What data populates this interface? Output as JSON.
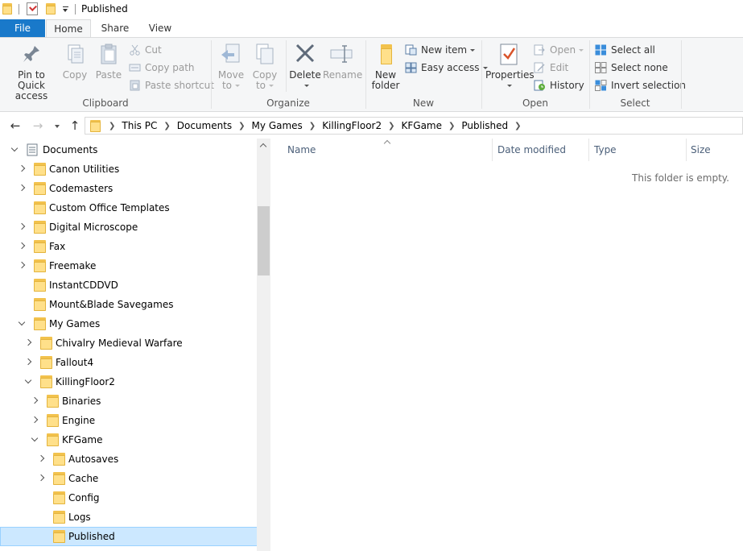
{
  "window": {
    "title": "Published"
  },
  "tabs": {
    "file": "File",
    "home": "Home",
    "share": "Share",
    "view": "View"
  },
  "ribbon": {
    "clipboard": {
      "label": "Clipboard",
      "pin_line1": "Pin to Quick",
      "pin_line2": "access",
      "copy": "Copy",
      "paste": "Paste",
      "cut": "Cut",
      "copy_path": "Copy path",
      "paste_shortcut": "Paste shortcut"
    },
    "organize": {
      "label": "Organize",
      "move_line1": "Move",
      "move_line2": "to",
      "copy_line1": "Copy",
      "copy_line2": "to",
      "delete": "Delete",
      "rename": "Rename"
    },
    "new": {
      "label": "New",
      "folder_line1": "New",
      "folder_line2": "folder",
      "new_item": "New item",
      "easy_access": "Easy access"
    },
    "open": {
      "label": "Open",
      "properties": "Properties",
      "open": "Open",
      "edit": "Edit",
      "history": "History"
    },
    "select": {
      "label": "Select",
      "select_all": "Select all",
      "select_none": "Select none",
      "invert_selection": "Invert selection"
    }
  },
  "address": {
    "crumbs": [
      "This PC",
      "Documents",
      "My Games",
      "KillingFloor2",
      "KFGame",
      "Published"
    ]
  },
  "tree": {
    "items": [
      {
        "label": "Documents"
      },
      {
        "label": "Canon Utilities"
      },
      {
        "label": "Codemasters"
      },
      {
        "label": "Custom Office Templates"
      },
      {
        "label": "Digital Microscope"
      },
      {
        "label": "Fax"
      },
      {
        "label": "Freemake"
      },
      {
        "label": "InstantCDDVD"
      },
      {
        "label": "Mount&Blade Savegames"
      },
      {
        "label": "My Games"
      },
      {
        "label": "Chivalry Medieval Warfare"
      },
      {
        "label": "Fallout4"
      },
      {
        "label": "KillingFloor2"
      },
      {
        "label": "Binaries"
      },
      {
        "label": "Engine"
      },
      {
        "label": "KFGame"
      },
      {
        "label": "Autosaves"
      },
      {
        "label": "Cache"
      },
      {
        "label": "Config"
      },
      {
        "label": "Logs"
      },
      {
        "label": "Published"
      }
    ]
  },
  "columns": {
    "name": "Name",
    "date_modified": "Date modified",
    "type": "Type",
    "size": "Size"
  },
  "content": {
    "empty_message": "This folder is empty."
  },
  "colors": {
    "accent": "#1979ca",
    "selection": "#cce8ff",
    "folder": "#ffe08a"
  }
}
